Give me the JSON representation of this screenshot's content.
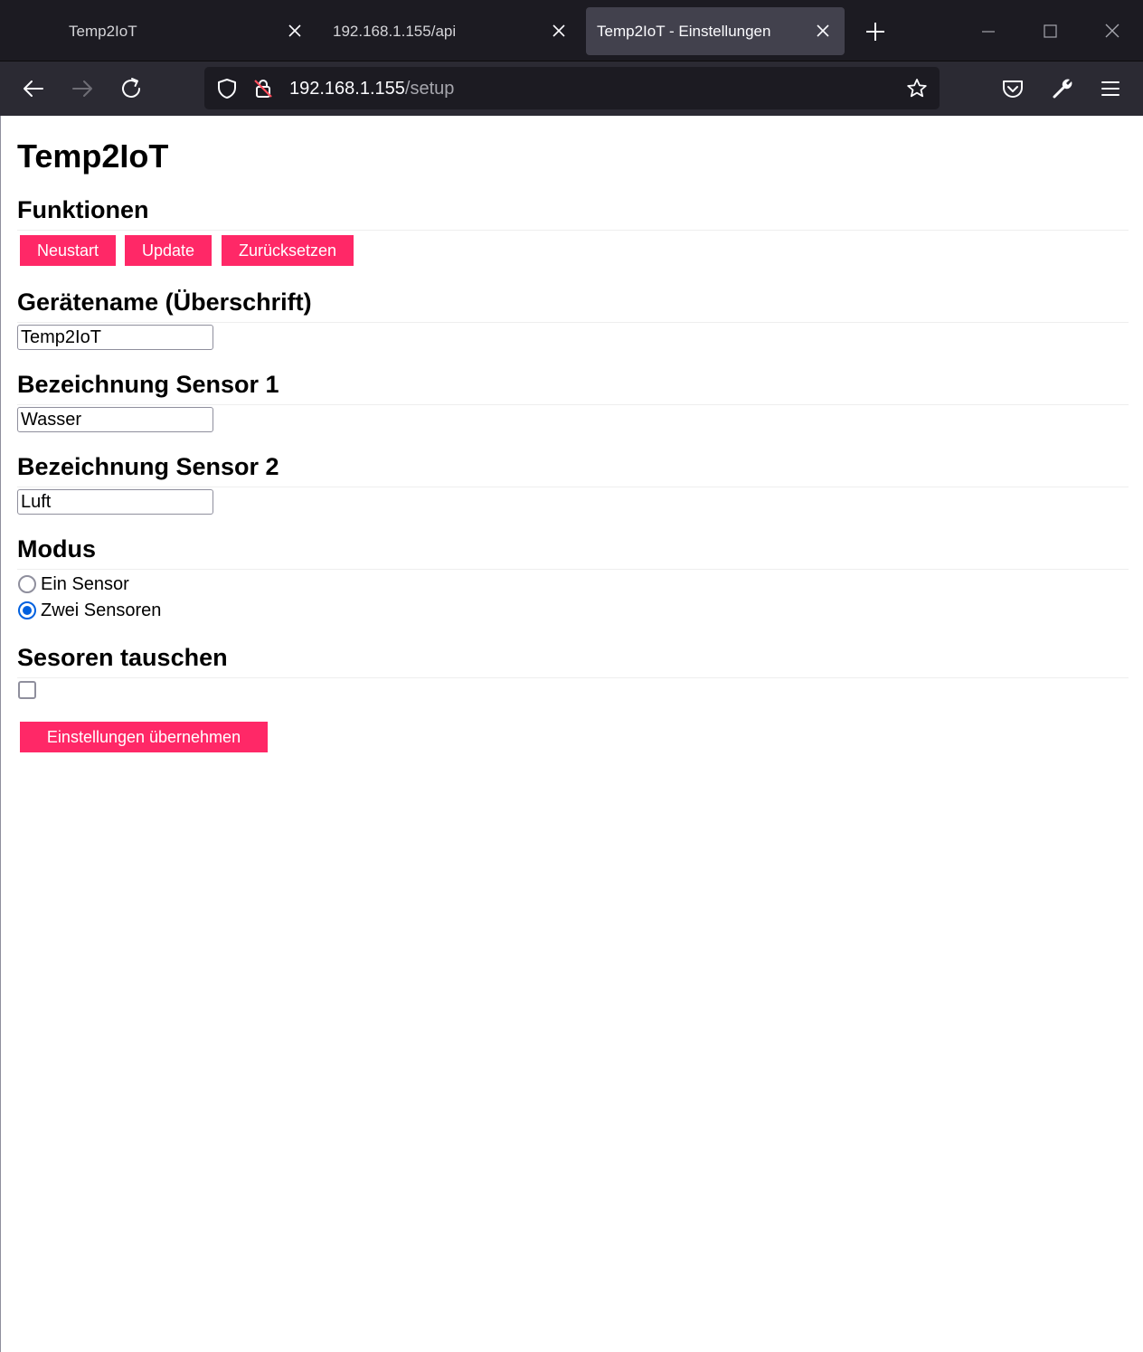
{
  "browser": {
    "tabs": [
      {
        "title": "Temp2IoT"
      },
      {
        "title": "192.168.1.155/api"
      },
      {
        "title": "Temp2IoT - Einstellungen"
      }
    ],
    "url": {
      "host": "192.168.1.155",
      "path": "/setup"
    }
  },
  "page": {
    "title": "Temp2IoT",
    "functions": {
      "heading": "Funktionen",
      "buttons": {
        "restart": "Neustart",
        "update": "Update",
        "reset": "Zurücksetzen"
      }
    },
    "device_name": {
      "heading": "Gerätename (Überschrift)",
      "value": "Temp2IoT"
    },
    "sensor1": {
      "heading": "Bezeichnung Sensor 1",
      "value": "Wasser"
    },
    "sensor2": {
      "heading": "Bezeichnung Sensor 2",
      "value": "Luft"
    },
    "mode": {
      "heading": "Modus",
      "options": [
        {
          "label": "Ein Sensor",
          "checked": false
        },
        {
          "label": "Zwei Sensoren",
          "checked": true
        }
      ]
    },
    "swap": {
      "heading": "Sesoren tauschen",
      "checked": false
    },
    "submit": "Einstellungen übernehmen"
  },
  "colors": {
    "accent": "#ff2867",
    "radio_checked": "#0060df"
  }
}
